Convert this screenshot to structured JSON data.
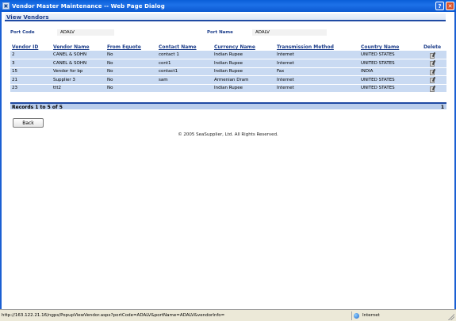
{
  "window": {
    "title": "Vendor Master Maintenance -- Web Page Dialog",
    "help_label": "?",
    "close_label": "✕"
  },
  "section": {
    "title": "View Vendors"
  },
  "filters": {
    "port_code_label": "Port Code",
    "port_code_value": "ADALV",
    "port_name_label": "Port Name",
    "port_name_value": "ADALV"
  },
  "table": {
    "columns": [
      "Vendor ID",
      "Vendor Name",
      "From Equote",
      "Contact Name",
      "Currency Name",
      "Transmission Method",
      "Country Name",
      "Delete"
    ],
    "rows": [
      [
        "2",
        "CANEL & SOHN",
        "No",
        "contact 1",
        "Indian Rupee",
        "Internet",
        "UNITED STATES"
      ],
      [
        "3",
        "CANEL & SOHN",
        "No",
        "cont1",
        "Indian Rupee",
        "Internet",
        "UNITED STATES"
      ],
      [
        "15",
        "Vendor for bp",
        "No",
        "contact1",
        "Indian Rupee",
        "Fax",
        "INDIA"
      ],
      [
        "21",
        "Supplier 3",
        "No",
        "sam",
        "Armenian Dram",
        "Internet",
        "UNITED STATES"
      ],
      [
        "23",
        "ttt2",
        "No",
        "",
        "Indian Rupee",
        "Internet",
        "UNITED STATES"
      ]
    ],
    "records_text": "Records 1 to 5 of 5",
    "page_number": "1"
  },
  "back_label": "Back",
  "copyright": "© 2005 SeaSupplier, Ltd. All Rights Reserved.",
  "statusbar": {
    "url": "http://163.122.21.16/ngps/PopupViewVendor.aspx?portCode=ADALV&portName=ADALV&vendorInfo=",
    "zone": "Internet"
  },
  "icons": {
    "app": "dialog-icon",
    "delete": "delete-icon",
    "zone": "globe-icon"
  },
  "colors": {
    "titlebar": "#0a5fd8",
    "row_bg": "#c9daf2",
    "footer_bg": "#b9cdeb",
    "header_text": "#1c3d8a"
  }
}
